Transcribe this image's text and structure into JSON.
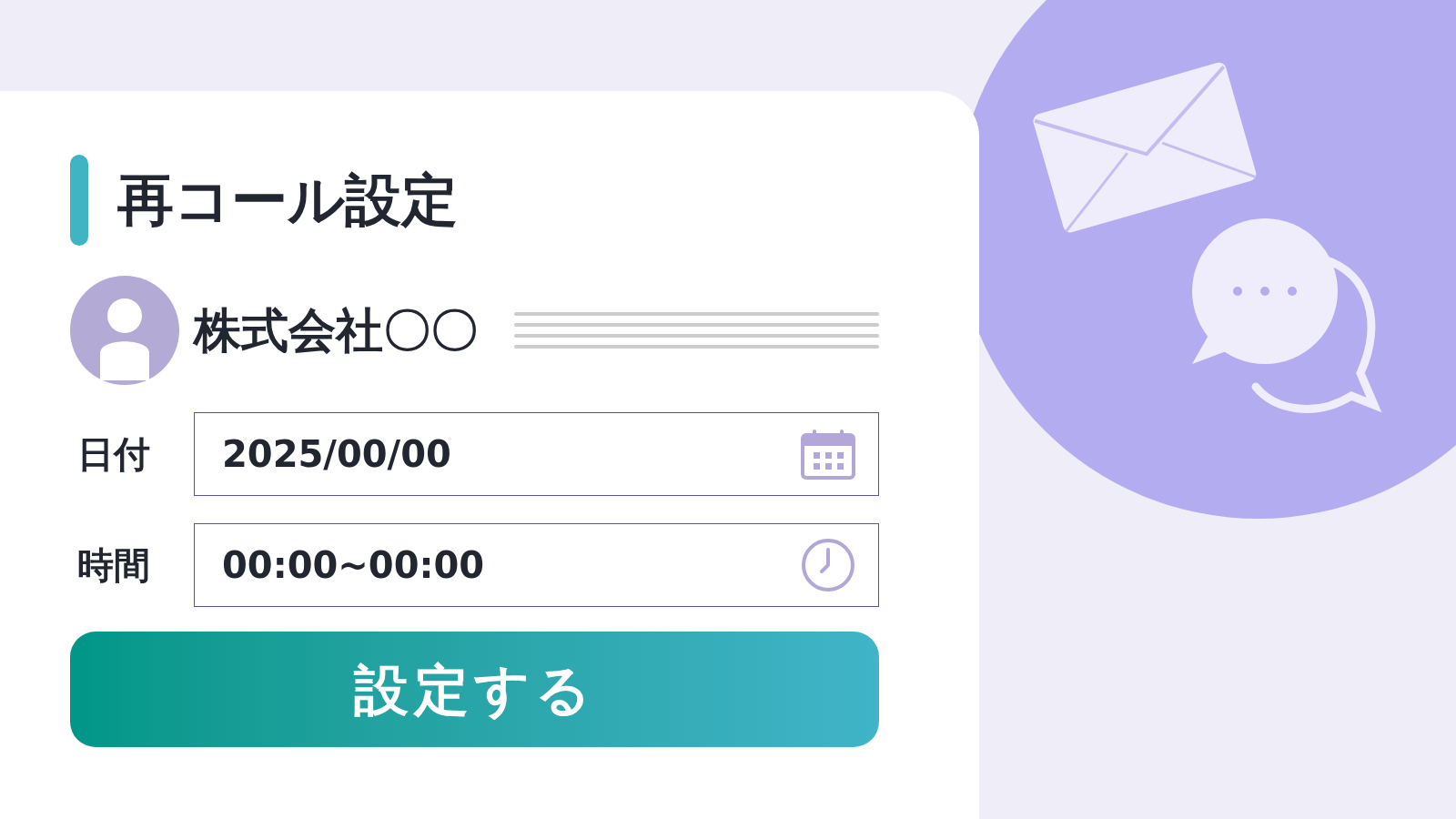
{
  "title": "再コール設定",
  "contact": {
    "name": "株式会社〇〇"
  },
  "fields": [
    {
      "label": "日付",
      "value": "2025/00/00",
      "kind": "date"
    },
    {
      "label": "時間",
      "value": "00:00~00:00",
      "kind": "time"
    }
  ],
  "submit_button": "設定する"
}
